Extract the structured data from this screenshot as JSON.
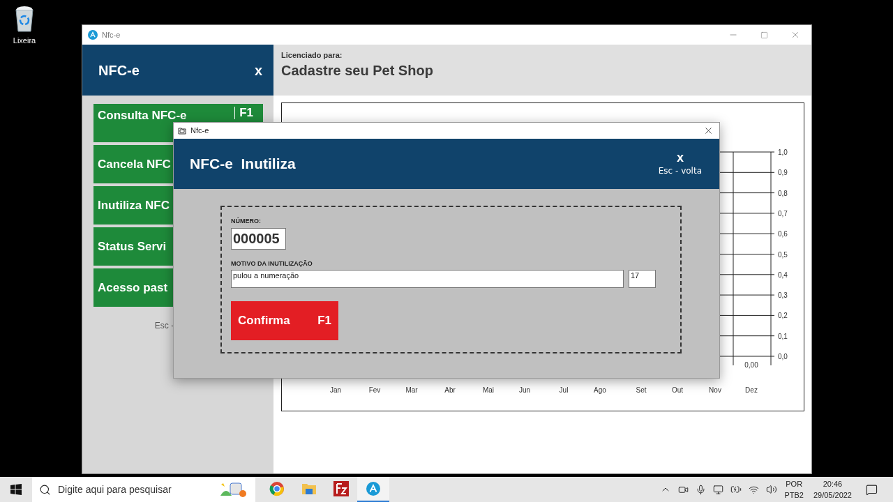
{
  "desktop_icons": [
    {
      "label": "Lixeira"
    }
  ],
  "main_window": {
    "title": "Nfc-e",
    "header": {
      "title": "NFC-e",
      "close": "x",
      "licensed_label": "Licenciado para:",
      "licensee": "Cadastre seu Pet Shop"
    },
    "sidebar": {
      "items": [
        {
          "label": "Consulta NFC-e",
          "key": "F1"
        },
        {
          "label": "Cancela NFC"
        },
        {
          "label": "Inutiliza NFC"
        },
        {
          "label": "Status Servi"
        },
        {
          "label": "Acesso past"
        }
      ],
      "footer": "Esc -"
    },
    "chart": {
      "months": [
        "Jan",
        "Fev",
        "Mar",
        "Abr",
        "Mai",
        "Jun",
        "Jul",
        "Ago",
        "Set",
        "Out",
        "Nov",
        "Dez"
      ],
      "y_labels": [
        "1,0",
        "0,9",
        "0,8",
        "0,7",
        "0,6",
        "0,5",
        "0,4",
        "0,3",
        "0,2",
        "0,1",
        "0,0"
      ],
      "value_label": "0,00"
    }
  },
  "dialog": {
    "title": "Nfc-e",
    "header": {
      "title": "NFC-e  Inutiliza",
      "close": "x",
      "hint": "Esc - volta"
    },
    "numero": {
      "label": "NÚMERO:",
      "value": "000005"
    },
    "motivo": {
      "label": "MOTIVO DA INUTILIZAÇÃO",
      "value": "pulou a numeração",
      "count": "17"
    },
    "confirm": {
      "label": "Confirma",
      "key": "F1"
    }
  },
  "taskbar": {
    "search_placeholder": "Digite aqui para pesquisar",
    "apps": [
      {
        "kind": "browser",
        "selected": false
      },
      {
        "kind": "folder",
        "selected": false
      },
      {
        "kind": "ftp",
        "selected": false
      },
      {
        "kind": "app",
        "selected": true
      }
    ],
    "language": [
      "POR",
      "PTB2"
    ],
    "time": "20:46",
    "date": "29/05/2022"
  }
}
